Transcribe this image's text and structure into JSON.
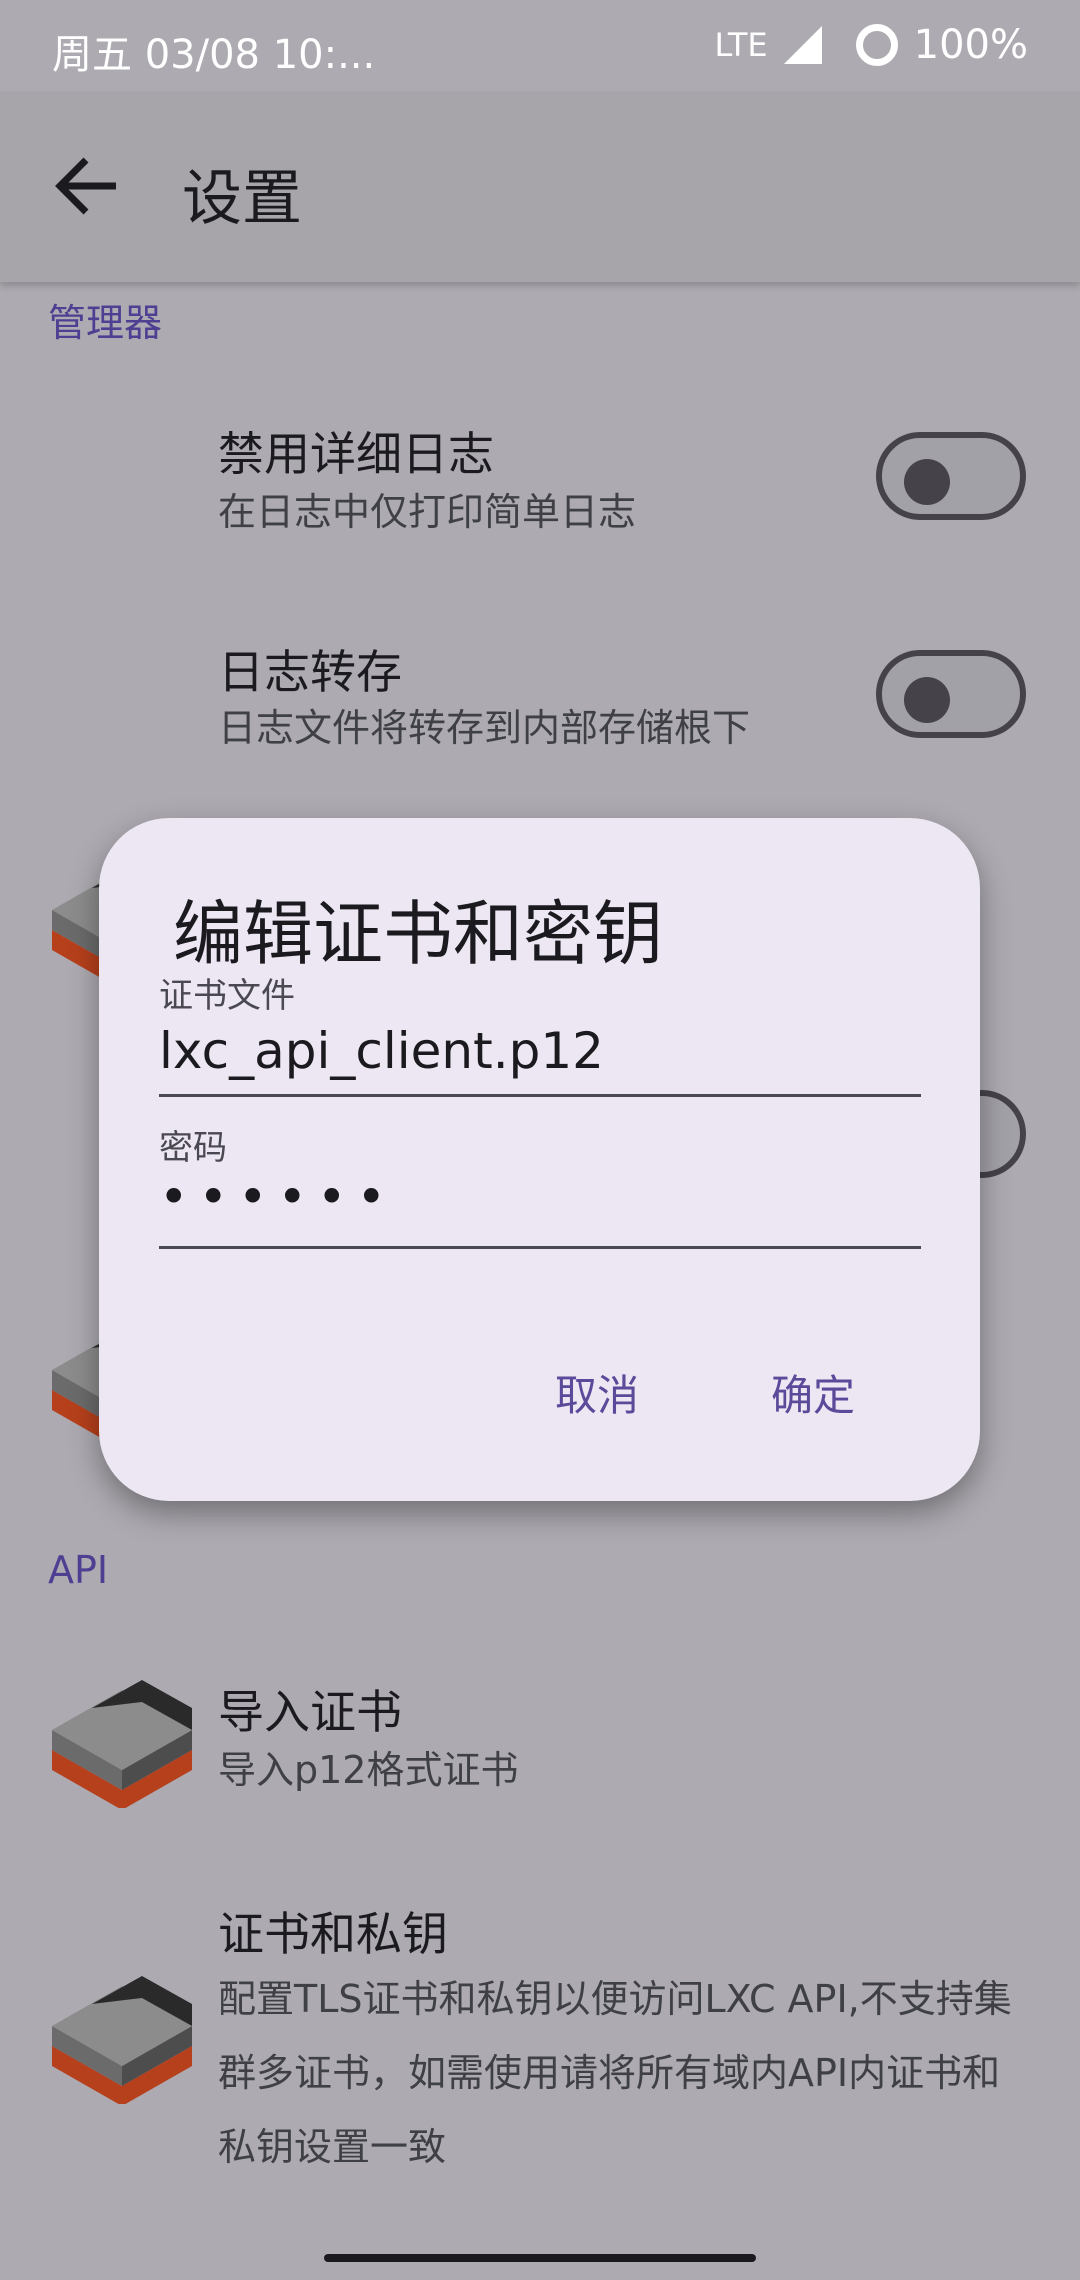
{
  "status_bar": {
    "time": "周五 03/08 10:...",
    "network": "LTE",
    "battery": "100%"
  },
  "app_bar": {
    "title": "设置"
  },
  "sections": {
    "manager": {
      "title": "管理器",
      "items": [
        {
          "title": "禁用详细日志",
          "subtitle": "在日志中仅打印简单日志",
          "switch_on": false
        },
        {
          "title": "日志转存",
          "subtitle": "日志文件将转存到内部存储根下",
          "switch_on": false
        }
      ]
    },
    "api": {
      "title": "API",
      "items": [
        {
          "title": "导入证书",
          "subtitle": "导入p12格式证书"
        },
        {
          "title": "证书和私钥",
          "subtitle": "配置TLS证书和私钥以便访问LXC API,不支持集群多证书，如需使用请将所有域内API内证书和私钥设置一致"
        }
      ]
    }
  },
  "dialog": {
    "title": "编辑证书和密钥",
    "cert_label": "证书文件",
    "cert_value": "lxc_api_client.p12",
    "password_label": "密码",
    "password_value": "••••••",
    "cancel_label": "取消",
    "confirm_label": "确定"
  },
  "colors": {
    "accent": "#4e3f92",
    "dialog_bg": "#ede6f3"
  }
}
